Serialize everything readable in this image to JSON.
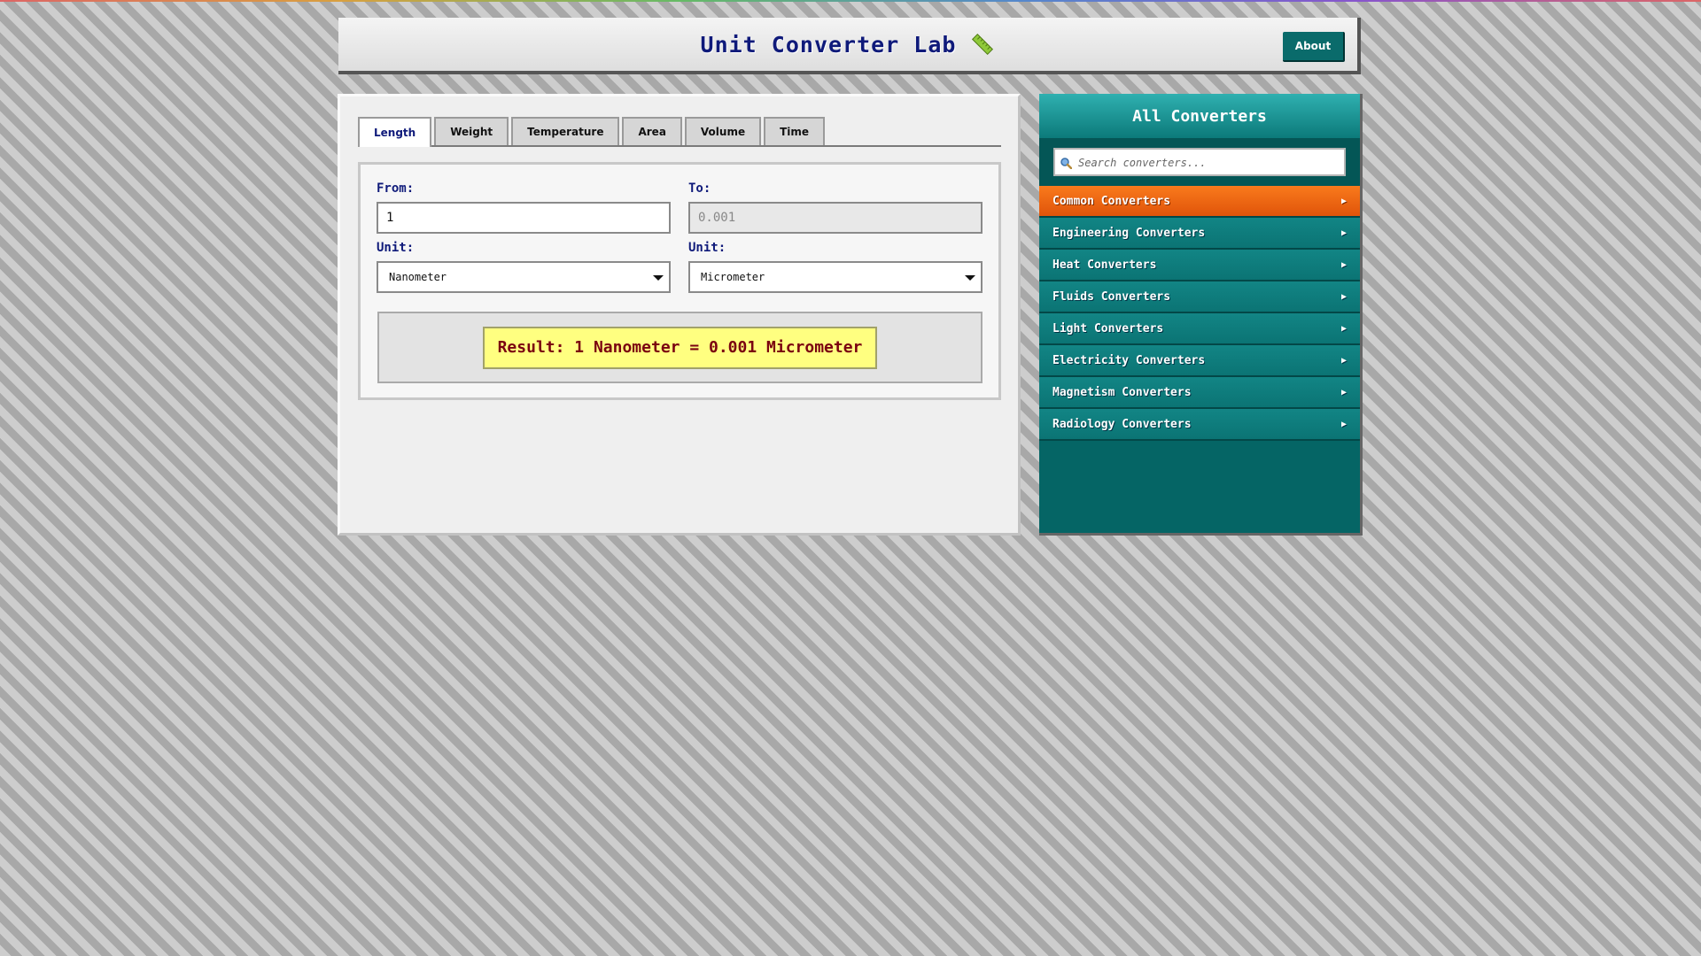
{
  "header": {
    "title": "Unit Converter Lab",
    "title_icon": "ruler-icon",
    "about_label": "About"
  },
  "tabs": [
    {
      "label": "Length",
      "active": true
    },
    {
      "label": "Weight",
      "active": false
    },
    {
      "label": "Temperature",
      "active": false
    },
    {
      "label": "Area",
      "active": false
    },
    {
      "label": "Volume",
      "active": false
    },
    {
      "label": "Time",
      "active": false
    }
  ],
  "converter": {
    "from_label": "From:",
    "from_value": "1",
    "to_label": "To:",
    "to_value": "0.001",
    "from_unit_label": "Unit:",
    "from_unit": "Nanometer",
    "to_unit_label": "Unit:",
    "to_unit": "Micrometer",
    "result": "Result: 1 Nanometer = 0.001 Micrometer"
  },
  "sidebar": {
    "title": "All Converters",
    "search_placeholder": "Search converters...",
    "search_icon": "search-icon",
    "items": [
      {
        "label": "Common Converters",
        "active": true
      },
      {
        "label": "Engineering Converters",
        "active": false
      },
      {
        "label": "Heat Converters",
        "active": false
      },
      {
        "label": "Fluids Converters",
        "active": false
      },
      {
        "label": "Light Converters",
        "active": false
      },
      {
        "label": "Electricity Converters",
        "active": false
      },
      {
        "label": "Magnetism Converters",
        "active": false
      },
      {
        "label": "Radiology Converters",
        "active": false
      }
    ],
    "arrow_glyph": "▶"
  },
  "colors": {
    "accent": "#0a6b6b",
    "active_item": "#e65c0e",
    "title": "#0f1a7a",
    "result_bg": "#ffff80",
    "result_text": "#7a0010"
  }
}
